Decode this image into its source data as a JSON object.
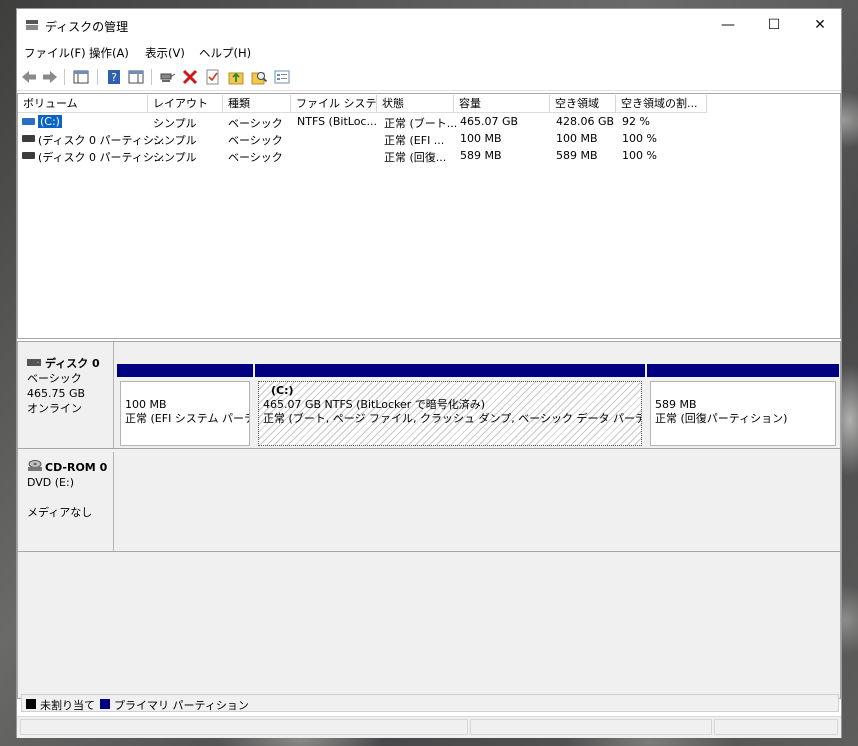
{
  "window": {
    "title": "ディスクの管理",
    "controls": {
      "minimize": "—",
      "maximize": "☐",
      "close": "✕"
    }
  },
  "menu": [
    "ファイル(F)",
    "操作(A)",
    "表示(V)",
    "ヘルプ(H)"
  ],
  "toolbar": {
    "icons": [
      "back-icon",
      "forward-icon",
      "console-tree-icon",
      "help-icon",
      "detail-view-icon",
      "connect-drive-icon",
      "delete-icon",
      "checklist-icon",
      "folder-up-icon",
      "search-folder-icon",
      "properties-icon"
    ]
  },
  "volume_list": {
    "columns": [
      "ボリューム",
      "レイアウト",
      "種類",
      "ファイル システム",
      "状態",
      "容量",
      "空き領域",
      "空き領域の割..."
    ],
    "rows": [
      {
        "volume": "(C:)",
        "layout": "シンプル",
        "type": "ベーシック",
        "fs": "NTFS (BitLoc...",
        "status": "正常 (ブート...",
        "capacity": "465.07 GB",
        "free": "428.06 GB",
        "pct": "92 %"
      },
      {
        "volume": "(ディスク 0 パーティシ...",
        "layout": "シンプル",
        "type": "ベーシック",
        "fs": "",
        "status": "正常 (EFI ...",
        "capacity": "100 MB",
        "free": "100 MB",
        "pct": "100 %"
      },
      {
        "volume": "(ディスク 0 パーティシ...",
        "layout": "シンプル",
        "type": "ベーシック",
        "fs": "",
        "status": "正常 (回復...",
        "capacity": "589 MB",
        "free": "589 MB",
        "pct": "100 %"
      }
    ]
  },
  "disks": [
    {
      "name": "ディスク 0",
      "type": "ベーシック",
      "size": "465.75 GB",
      "state": "オンライン",
      "partitions": [
        {
          "title": "",
          "line1": "100 MB",
          "line2": "正常 (EFI システム パーティ"
        },
        {
          "title": "(C:)",
          "line1": "465.07 GB NTFS (BitLocker で暗号化済み)",
          "line2": "正常 (ブート, ページ ファイル, クラッシュ ダンプ, ベーシック データ パーティション)"
        },
        {
          "title": "",
          "line1": "589 MB",
          "line2": "正常 (回復パーティション)"
        }
      ]
    },
    {
      "name": "CD-ROM 0",
      "type": "DVD (E:)",
      "state": "メディアなし"
    }
  ],
  "legend": [
    {
      "label": "未割り当て",
      "color": "#000000"
    },
    {
      "label": "プライマリ パーティション",
      "color": "#000080"
    }
  ]
}
